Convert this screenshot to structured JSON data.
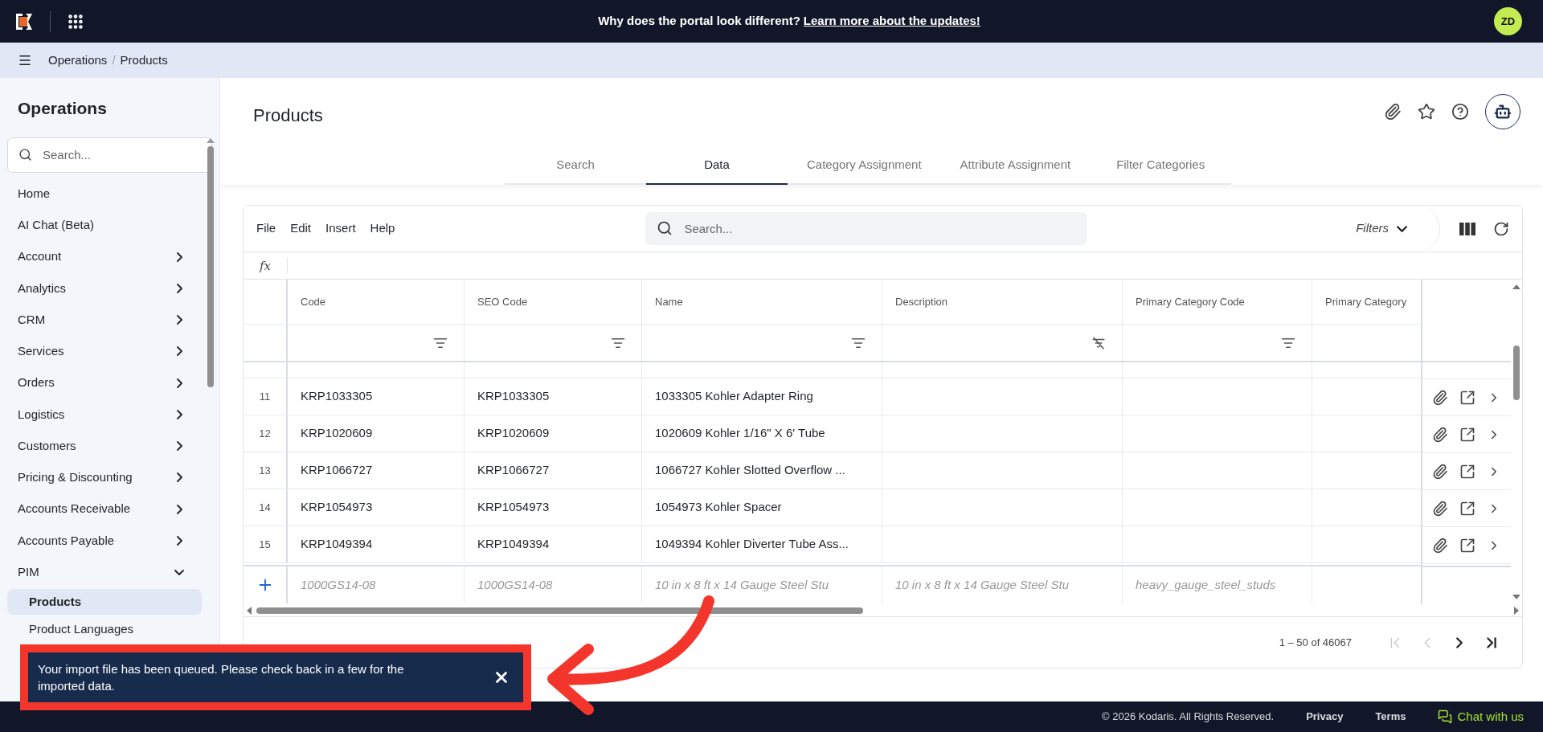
{
  "top_bar": {
    "banner_text": "Why does the portal look different?",
    "banner_link": "Learn more about the updates!",
    "avatar": "ZD"
  },
  "breadcrumb": {
    "items": [
      "Operations",
      "Products"
    ],
    "separator": "/"
  },
  "sidebar": {
    "title": "Operations",
    "search_placeholder": "Search...",
    "items": [
      {
        "label": "Home",
        "kind": "link",
        "selected": false
      },
      {
        "label": "AI Chat (Beta)",
        "kind": "link",
        "selected": false
      },
      {
        "label": "Account",
        "kind": "group",
        "expanded": false
      },
      {
        "label": "Analytics",
        "kind": "group",
        "expanded": false
      },
      {
        "label": "CRM",
        "kind": "group",
        "expanded": false
      },
      {
        "label": "Services",
        "kind": "group",
        "expanded": false
      },
      {
        "label": "Orders",
        "kind": "group",
        "expanded": false
      },
      {
        "label": "Logistics",
        "kind": "group",
        "expanded": false
      },
      {
        "label": "Customers",
        "kind": "group",
        "expanded": false
      },
      {
        "label": "Pricing & Discounting",
        "kind": "group",
        "expanded": false
      },
      {
        "label": "Accounts Receivable",
        "kind": "group",
        "expanded": false
      },
      {
        "label": "Accounts Payable",
        "kind": "group",
        "expanded": false
      },
      {
        "label": "PIM",
        "kind": "group",
        "expanded": true,
        "children": [
          {
            "label": "Products",
            "selected": true
          },
          {
            "label": "Product Languages",
            "selected": false
          }
        ]
      }
    ]
  },
  "page": {
    "title": "Products",
    "tabs": [
      {
        "label": "Search",
        "selected": false
      },
      {
        "label": "Data",
        "selected": true
      },
      {
        "label": "Category Assignment",
        "selected": false
      },
      {
        "label": "Attribute Assignment",
        "selected": false
      },
      {
        "label": "Filter Categories",
        "selected": false
      }
    ]
  },
  "grid": {
    "menu": [
      "File",
      "Edit",
      "Insert",
      "Help"
    ],
    "search_placeholder": "Search...",
    "filters_label": "Filters",
    "formula_label": "fx",
    "columns": [
      {
        "label": "Code",
        "kind": "filtered"
      },
      {
        "label": "SEO Code",
        "kind": "filtered"
      },
      {
        "label": "Name",
        "kind": "filtered"
      },
      {
        "label": "Description",
        "kind": "unfiltered"
      },
      {
        "label": "Primary Category Code",
        "kind": "filtered"
      },
      {
        "label": "Primary Category",
        "kind": "plain"
      }
    ],
    "rows": [
      {
        "number": "11",
        "cells": [
          "KRP1033305",
          "KRP1033305",
          "1033305 Kohler Adapter Ring"
        ]
      },
      {
        "number": "12",
        "cells": [
          "KRP1020609",
          "KRP1020609",
          "1020609 Kohler 1/16\" X 6' Tube"
        ]
      },
      {
        "number": "13",
        "cells": [
          "KRP1066727",
          "KRP1066727",
          "1066727 Kohler Slotted Overflow ..."
        ]
      },
      {
        "number": "14",
        "cells": [
          "KRP1054973",
          "KRP1054973",
          "1054973 Kohler Spacer"
        ]
      },
      {
        "number": "15",
        "cells": [
          "KRP1049394",
          "KRP1049394",
          "1049394 Kohler Diverter Tube Ass..."
        ]
      }
    ],
    "new_row": [
      "1000GS14-08",
      "1000GS14-08",
      "10 in x 8 ft x 14 Gauge Steel Stu",
      "10 in x 8 ft x 14 Gauge Steel Stu",
      "heavy_gauge_steel_studs"
    ],
    "pager": {
      "range": "1 – 50 of 46067",
      "buttons": [
        {
          "kind": "first",
          "disabled": true
        },
        {
          "kind": "previous",
          "disabled": true
        },
        {
          "kind": "next",
          "disabled": false
        },
        {
          "kind": "last",
          "disabled": false
        }
      ]
    }
  },
  "toast": {
    "message": "Your import file has been queued. Please check back in a few for the imported data."
  },
  "footer": {
    "copyright": "© 2026 Kodaris. All Rights Reserved.",
    "links": [
      "Privacy",
      "Terms"
    ],
    "chat": "Chat with us"
  }
}
